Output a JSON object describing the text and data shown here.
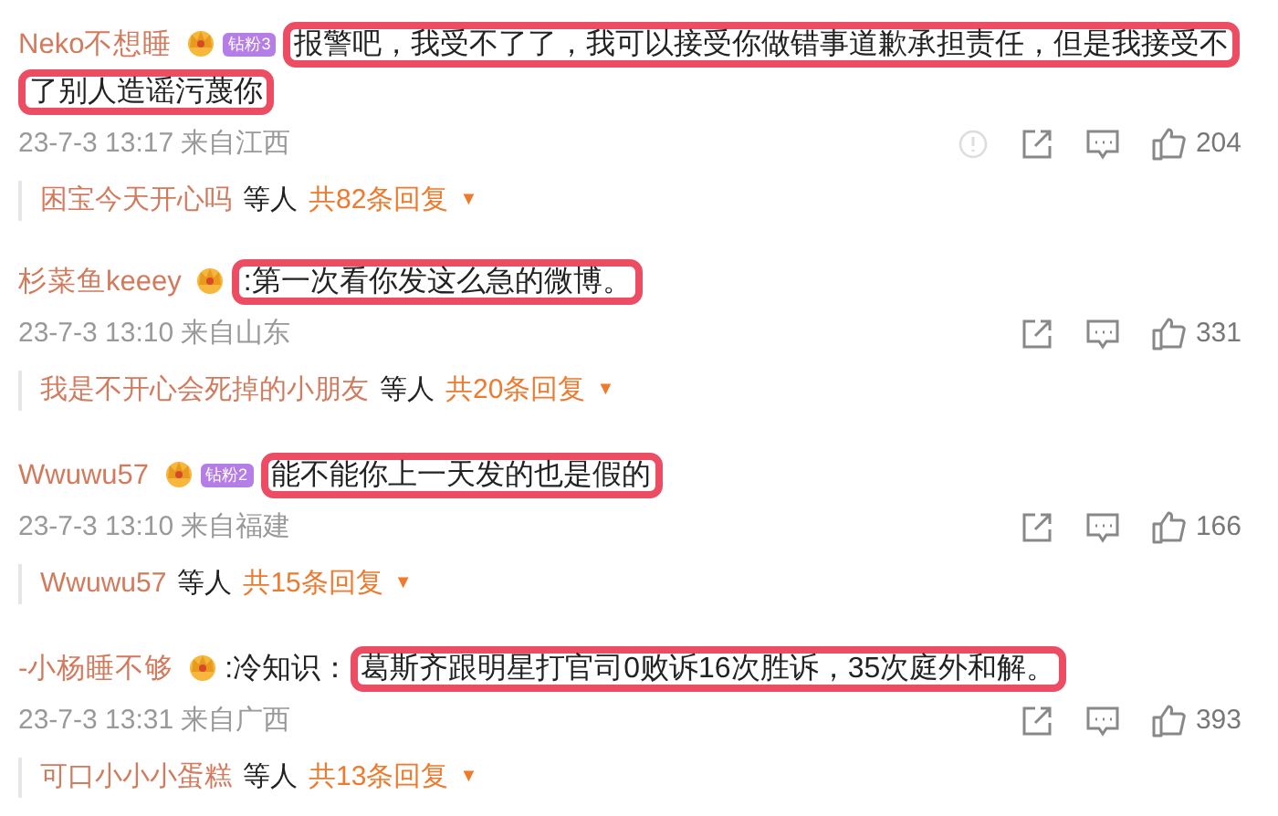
{
  "comments": [
    {
      "user": "Neko不想睡",
      "fan_badge": "钻粉3",
      "segments": [
        {
          "text": "报警吧，我受不了了，我可以接受你做错事道歉承担责任，但是我接受不",
          "highlighted": true
        },
        {
          "text": "了别人造谣污蔑你",
          "highlighted": true
        }
      ],
      "meta": "23-7-3 13:17 来自江西",
      "report": true,
      "likes": "204",
      "reply_user": "困宝今天开心吗",
      "reply_suffix": "等人",
      "reply_count": "共82条回复",
      "reply_caret": "▼"
    },
    {
      "user": "杉菜鱼keeey",
      "segments": [
        {
          "text": ":第一次看你发这么急的微博。",
          "highlighted": true
        }
      ],
      "meta": "23-7-3 13:10 来自山东",
      "report": false,
      "likes": "331",
      "reply_user": "我是不开心会死掉的小朋友",
      "reply_suffix": "等人",
      "reply_count": "共20条回复",
      "reply_caret": "▼"
    },
    {
      "user": "Wwuwu57",
      "fan_badge": "钻粉2",
      "segments": [
        {
          "text": "能不能你上一天发的也是假的",
          "highlighted": true
        }
      ],
      "meta": "23-7-3 13:10 来自福建",
      "report": false,
      "likes": "166",
      "reply_user": "Wwuwu57",
      "reply_suffix": "等人",
      "reply_count": "共15条回复",
      "reply_caret": "▼"
    },
    {
      "user": "-小杨睡不够",
      "segments": [
        {
          "text": ":冷知识：",
          "highlighted": false
        },
        {
          "text": "葛斯齐跟明星打官司0败诉16次胜诉，35次庭外和解。",
          "highlighted": true
        }
      ],
      "meta": "23-7-3 13:31 来自广西",
      "report": false,
      "likes": "393",
      "reply_user": "可口小小小蛋糕",
      "reply_suffix": "等人",
      "reply_count": "共13条回复",
      "reply_caret": "▼"
    }
  ]
}
